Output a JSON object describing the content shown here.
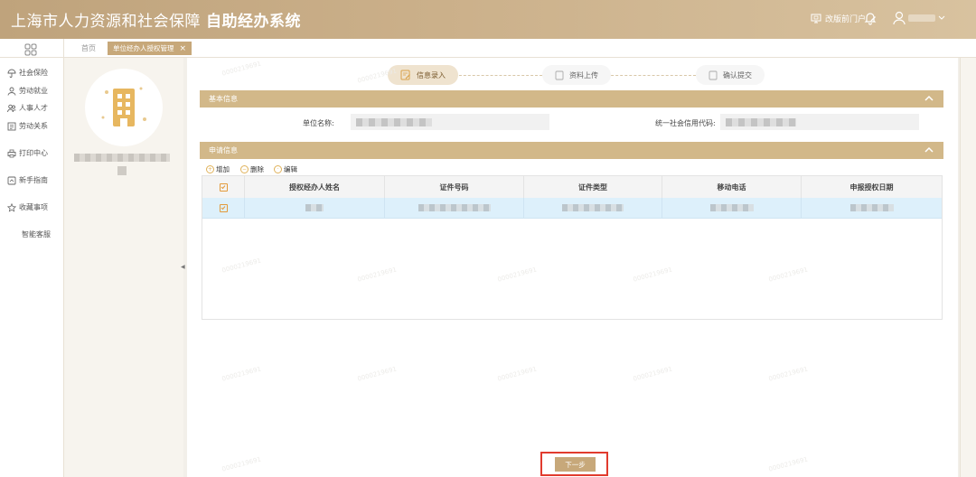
{
  "header": {
    "title_part1": "上海市人力资源和社会保障",
    "title_part2": "自助经办系统",
    "portal_link": "改版前门户"
  },
  "sidebar": {
    "items": [
      {
        "label": "社会保险",
        "icon": "umbrella-icon"
      },
      {
        "label": "劳动就业",
        "icon": "worker-icon"
      },
      {
        "label": "人事人才",
        "icon": "people-icon"
      },
      {
        "label": "劳动关系",
        "icon": "document-icon"
      },
      {
        "label": "打印中心",
        "icon": "printer-icon"
      },
      {
        "label": "新手指南",
        "icon": "guide-icon"
      },
      {
        "label": "收藏事项",
        "icon": "star-icon"
      },
      {
        "label": "智能客服",
        "icon": "none"
      }
    ]
  },
  "tabs": {
    "home": "首页",
    "active": "单位经办人授权管理",
    "close": "×"
  },
  "steps": [
    {
      "label": "信息录入",
      "state": "active"
    },
    {
      "label": "资料上传",
      "state": "pending"
    },
    {
      "label": "确认提交",
      "state": "pending"
    }
  ],
  "basic_info": {
    "title": "基本信息",
    "unit_name_label": "单位名称:",
    "credit_code_label": "统一社会信用代码:"
  },
  "apply_info": {
    "title": "申请信息",
    "toolbar": {
      "add": "增加",
      "delete": "删除",
      "edit": "编辑"
    },
    "columns": [
      "授权经办人姓名",
      "证件号码",
      "证件类型",
      "移动电话",
      "申报授权日期"
    ]
  },
  "footer": {
    "next_label": "下一步"
  },
  "watermark": "0000219691",
  "colors": {
    "accent": "#c7a87a",
    "header": "#cbb08a",
    "section": "#d2b889",
    "selected_row": "#ddf0fb",
    "highlight_outline": "#e13b2e"
  }
}
